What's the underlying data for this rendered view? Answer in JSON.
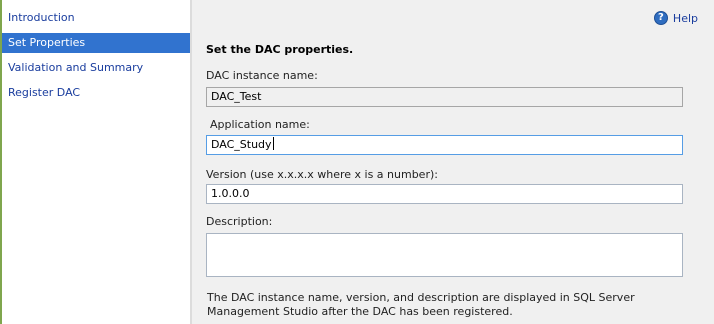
{
  "sidebar": {
    "items": [
      {
        "label": "Introduction",
        "selected": false
      },
      {
        "label": "Set Properties",
        "selected": true
      },
      {
        "label": "Validation and Summary",
        "selected": false
      },
      {
        "label": "Register DAC",
        "selected": false
      }
    ]
  },
  "help": {
    "label": "Help",
    "icon": "help-icon"
  },
  "main": {
    "heading": "Set the DAC properties.",
    "instance_name": {
      "label": "DAC instance name:",
      "value": "DAC_Test"
    },
    "application_name": {
      "label": "Application name:",
      "value": "DAC_Study"
    },
    "version": {
      "label": "Version (use x.x.x.x where x is a number):",
      "value": "1.0.0.0"
    },
    "description": {
      "label": "Description:",
      "value": ""
    },
    "note": "The DAC instance name, version, and description are displayed in SQL Server Management Studio after the DAC has been registered."
  },
  "colors": {
    "accent": "#3173cf",
    "link": "#1a3d9e",
    "sidebar_border": "#7fa64d"
  }
}
